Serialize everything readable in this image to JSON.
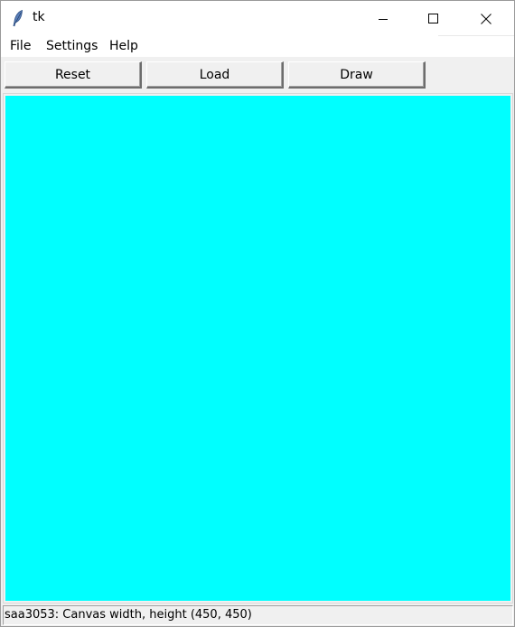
{
  "window": {
    "title": "tk",
    "icons": {
      "app": "feather-icon",
      "minimize": "minimize-icon",
      "maximize": "maximize-icon",
      "close": "close-icon"
    }
  },
  "menubar": {
    "items": [
      {
        "label": "File"
      },
      {
        "label": "Settings"
      },
      {
        "label": "Help"
      }
    ]
  },
  "toolbar": {
    "buttons": [
      {
        "label": "Reset"
      },
      {
        "label": "Load"
      },
      {
        "label": "Draw"
      }
    ]
  },
  "canvas": {
    "background_color": "#00ffff"
  },
  "statusbar": {
    "text": "saa3053: Canvas width, height (450, 450)"
  }
}
